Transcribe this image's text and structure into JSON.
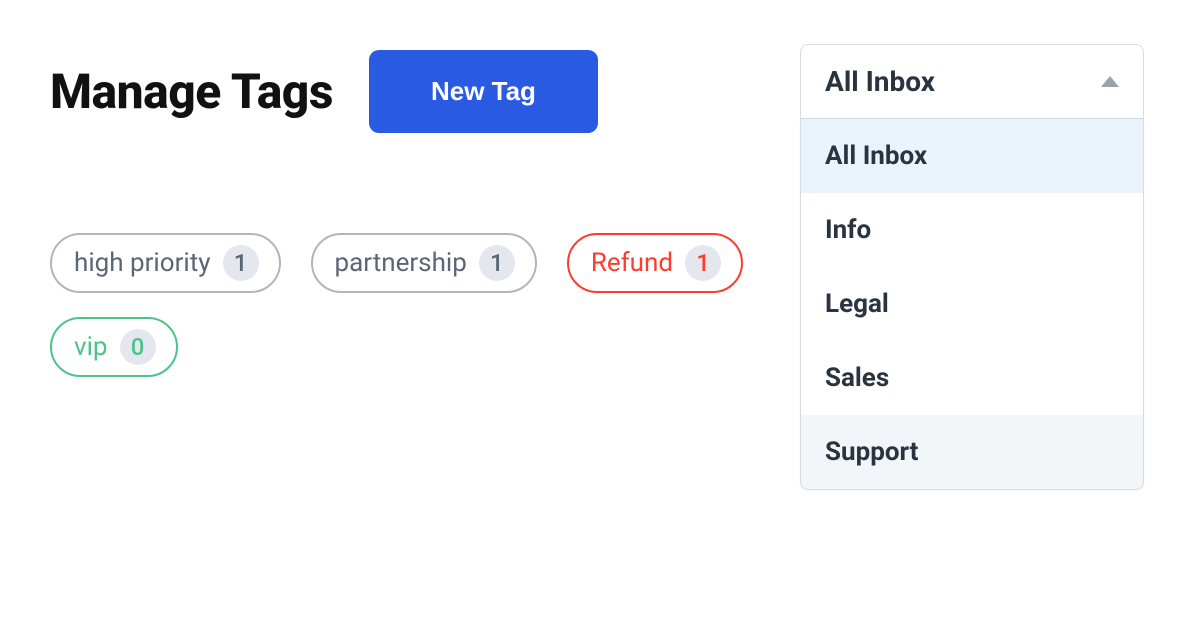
{
  "page": {
    "title": "Manage Tags"
  },
  "buttons": {
    "new_tag": "New Tag"
  },
  "tags": [
    {
      "label": "high priority",
      "count": 1,
      "color": "gray"
    },
    {
      "label": "partnership",
      "count": 1,
      "color": "gray"
    },
    {
      "label": "Refund",
      "count": 1,
      "color": "red"
    },
    {
      "label": "vip",
      "count": 0,
      "color": "green"
    }
  ],
  "inbox_filter": {
    "selected": "All Inbox",
    "options": [
      "All Inbox",
      "Info",
      "Legal",
      "Sales",
      "Support"
    ]
  }
}
